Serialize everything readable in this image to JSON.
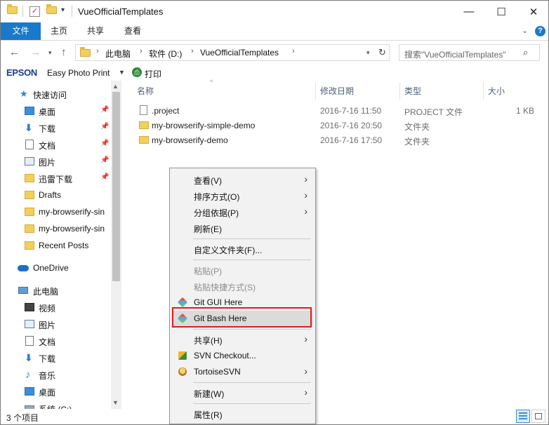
{
  "window": {
    "title": "VueOfficialTemplates",
    "controls": {
      "minimize": "—",
      "maximize": "☐",
      "close": "✕"
    }
  },
  "ribbon": {
    "tabs": [
      "文件",
      "主页",
      "共享",
      "查看"
    ],
    "expand_glyph": "⌄",
    "help_glyph": "?"
  },
  "address": {
    "breadcrumbs": [
      "此电脑",
      "软件 (D:)",
      "VueOfficialTemplates"
    ],
    "search_placeholder": "搜索\"VueOfficialTemplates\""
  },
  "toolbar": {
    "brand": "EPSON",
    "app": "Easy Photo Print",
    "dropdown": "▼",
    "print": "打印"
  },
  "nav_pane": {
    "quick_access_label": "快速访问",
    "quick_items": [
      {
        "label": "桌面",
        "icon": "desktop-icon",
        "pinned": true
      },
      {
        "label": "下载",
        "icon": "download-icon",
        "pinned": true
      },
      {
        "label": "文档",
        "icon": "document-icon",
        "pinned": true
      },
      {
        "label": "图片",
        "icon": "pictures-icon",
        "pinned": true
      },
      {
        "label": "迅雷下载",
        "icon": "folder-icon",
        "pinned": true
      },
      {
        "label": "Drafts",
        "icon": "folder-icon",
        "pinned": false
      },
      {
        "label": "my-browserify-sin",
        "icon": "folder-icon",
        "pinned": false
      },
      {
        "label": "my-browserify-sin",
        "icon": "folder-icon",
        "pinned": false
      },
      {
        "label": "Recent Posts",
        "icon": "folder-icon",
        "pinned": false
      }
    ],
    "onedrive_label": "OneDrive",
    "pc_label": "此电脑",
    "pc_items": [
      {
        "label": "视频",
        "icon": "video-icon"
      },
      {
        "label": "图片",
        "icon": "pictures-icon"
      },
      {
        "label": "文档",
        "icon": "document-icon"
      },
      {
        "label": "下载",
        "icon": "download-icon"
      },
      {
        "label": "音乐",
        "icon": "music-icon"
      },
      {
        "label": "桌面",
        "icon": "desktop-icon"
      },
      {
        "label": "系统 (C:)",
        "icon": "drive-icon"
      }
    ]
  },
  "columns": {
    "name": "名称",
    "modified": "修改日期",
    "type": "类型",
    "size": "大小"
  },
  "files": [
    {
      "name": ".project",
      "modified": "2016-7-16 11:50",
      "type": "PROJECT 文件",
      "size": "1 KB",
      "icon": "file-icon"
    },
    {
      "name": "my-browserify-simple-demo",
      "modified": "2016-7-16 20:50",
      "type": "文件夹",
      "size": "",
      "icon": "folder-icon"
    },
    {
      "name": "my-browserify-demo",
      "modified": "2016-7-16 17:50",
      "type": "文件夹",
      "size": "",
      "icon": "folder-icon"
    }
  ],
  "status": {
    "count": "3 个项目"
  },
  "context_menu": {
    "view": "查看(V)",
    "sort": "排序方式(O)",
    "group": "分组依据(P)",
    "refresh": "刷新(E)",
    "customize": "自定义文件夹(F)...",
    "paste": "粘贴(P)",
    "paste_shortcut": "粘贴快捷方式(S)",
    "git_gui": "Git GUI Here",
    "git_bash": "Git Bash Here",
    "share": "共享(H)",
    "svn_checkout": "SVN Checkout...",
    "tortoise": "TortoiseSVN",
    "new": "新建(W)",
    "properties": "属性(R)"
  },
  "colors": {
    "accent": "#1979ca",
    "highlight_border": "#e21b1b"
  }
}
